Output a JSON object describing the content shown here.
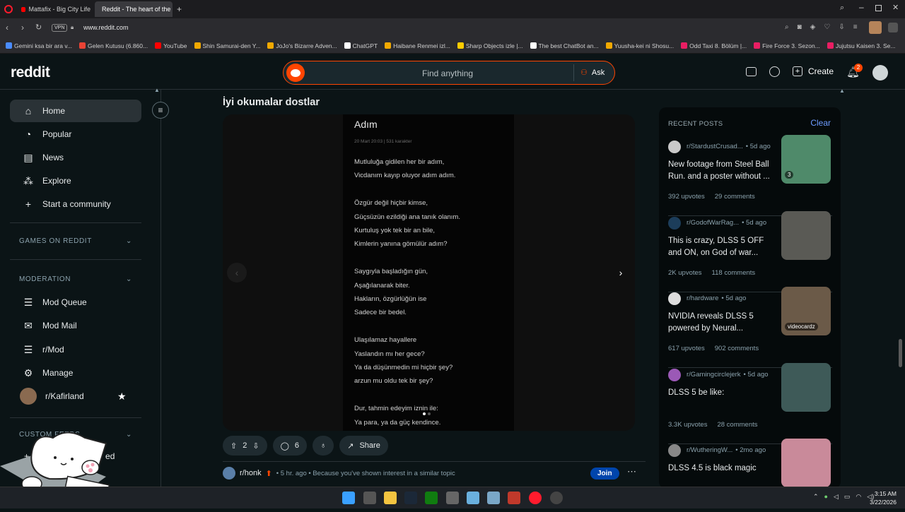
{
  "browser": {
    "tabs": [
      {
        "label": "Mattafix - Big City Life",
        "active": false
      },
      {
        "label": "Reddit - The heart of the",
        "active": true
      }
    ],
    "url": "www.reddit.com",
    "vpn_label": "VPN",
    "bookmarks": [
      {
        "label": "Gemini ksa bir ara v...",
        "color": "#4a8cff"
      },
      {
        "label": "Gelen Kutusu (6.860...",
        "color": "#ea4335"
      },
      {
        "label": "YouTube",
        "color": "#ff0000"
      },
      {
        "label": "Shin Samurai-den Y...",
        "color": "#f2a900"
      },
      {
        "label": "JoJo's Bizarre Adven...",
        "color": "#f2a900"
      },
      {
        "label": "ChatGPT",
        "color": "#ffffff"
      },
      {
        "label": "Haibane Renmei izl...",
        "color": "#f2a900"
      },
      {
        "label": "Sharp Objects izle |...",
        "color": "#ffcc00"
      },
      {
        "label": "The best ChatBot an...",
        "color": "#ffffff"
      },
      {
        "label": "Yuusha-kei ni Shosu...",
        "color": "#f2a900"
      },
      {
        "label": "Odd Taxi 8. Bölüm |...",
        "color": "#e91e63"
      },
      {
        "label": "Fire Force 3. Sezon...",
        "color": "#e91e63"
      },
      {
        "label": "Jujutsu Kaisen 3. Se...",
        "color": "#e91e63"
      }
    ]
  },
  "header": {
    "logo": "reddit",
    "search_placeholder": "Find anything",
    "ask_label": "Ask",
    "create_label": "Create",
    "notif_count": "2"
  },
  "sidebar": {
    "nav": [
      {
        "label": "Home",
        "icon": "home-icon"
      },
      {
        "label": "Popular",
        "icon": "popular-icon"
      },
      {
        "label": "News",
        "icon": "news-icon"
      },
      {
        "label": "Explore",
        "icon": "explore-icon"
      },
      {
        "label": "Start a community",
        "icon": "plus-icon"
      }
    ],
    "games_label": "GAMES ON REDDIT",
    "moderation_label": "MODERATION",
    "mod_items": [
      {
        "label": "Mod Queue"
      },
      {
        "label": "Mod Mail"
      },
      {
        "label": "r/Mod"
      },
      {
        "label": "Manage"
      },
      {
        "label": "r/Kafirland"
      }
    ],
    "custom_feeds_label": "CUSTOM FEEDS",
    "create_feed_label": "ed"
  },
  "post": {
    "title": "İyi okumalar dostlar",
    "doc_title": "Adım",
    "doc_meta": "20 Mart 20:03   |   531 karakter",
    "lines": [
      "Mutluluğa gidilen her bir adım,",
      "Vicdanım kayıp oluyor adım adım.",
      "",
      "Özgür değil hiçbir kimse,",
      "Güçsüzün ezildiği ana tanık olanım.",
      "Kurtuluş yok tek bir an bile,",
      "Kimlerin yanına gömülür adım?",
      "",
      "Saygıyla başladığın gün,",
      "Aşağılanarak biter.",
      "Hakların, özgürlüğün ise",
      "Sadece bir bedel.",
      "",
      "Ulaşılamaz hayallere",
      "Yaslandın mı her gece?",
      "Ya da düşünmedin mi hiçbir şey?",
      "arzun mu oldu tek bir şey?",
      "",
      "Dur, tahmin edeyim iznin ile:",
      "Ya para, ya da güç kendince."
    ],
    "votes": "2",
    "comments": "6",
    "share_label": "Share"
  },
  "next_post": {
    "subreddit": "r/honk",
    "meta": "• 5 hr. ago • Because you've shown interest in a similar topic",
    "join_label": "Join"
  },
  "recent": {
    "header": "RECENT POSTS",
    "clear_label": "Clear",
    "posts": [
      {
        "sub": "r/StardustCrusad...",
        "age": "• 5d ago",
        "title": "New footage from Steel Ball Run. and a poster without ...",
        "upvotes": "392 upvotes",
        "comments": "29 comments",
        "badge": "3",
        "thumb": "#4f8a6a",
        "avatar": "#c9c9c9"
      },
      {
        "sub": "r/GodofWarRag...",
        "age": "• 5d ago",
        "title": "This is crazy, DLSS 5 OFF and ON, on God of war...",
        "upvotes": "2K upvotes",
        "comments": "118 comments",
        "badge": "",
        "thumb": "#5a5a55",
        "avatar": "#1c3d5a"
      },
      {
        "sub": "r/hardware",
        "age": "• 5d ago",
        "title": "NVIDIA reveals DLSS 5 powered by Neural...",
        "upvotes": "617 upvotes",
        "comments": "902 comments",
        "badge": "videocardz",
        "thumb": "#6b5a48",
        "avatar": "#dddddd"
      },
      {
        "sub": "r/Gamingcirclejerk",
        "age": "• 5d ago",
        "title": "DLSS 5 be like:",
        "upvotes": "3.3K upvotes",
        "comments": "28 comments",
        "badge": "",
        "thumb": "#3e5a58",
        "avatar": "#9b59b6"
      },
      {
        "sub": "r/WutheringW...",
        "age": "• 2mo ago",
        "title": "DLSS 4.5 is black magic",
        "upvotes": "",
        "comments": "",
        "badge": "",
        "thumb": "#c98a9a",
        "avatar": "#888888"
      }
    ]
  },
  "taskbar": {
    "time": "3:15 AM",
    "date": "3/22/2026"
  }
}
